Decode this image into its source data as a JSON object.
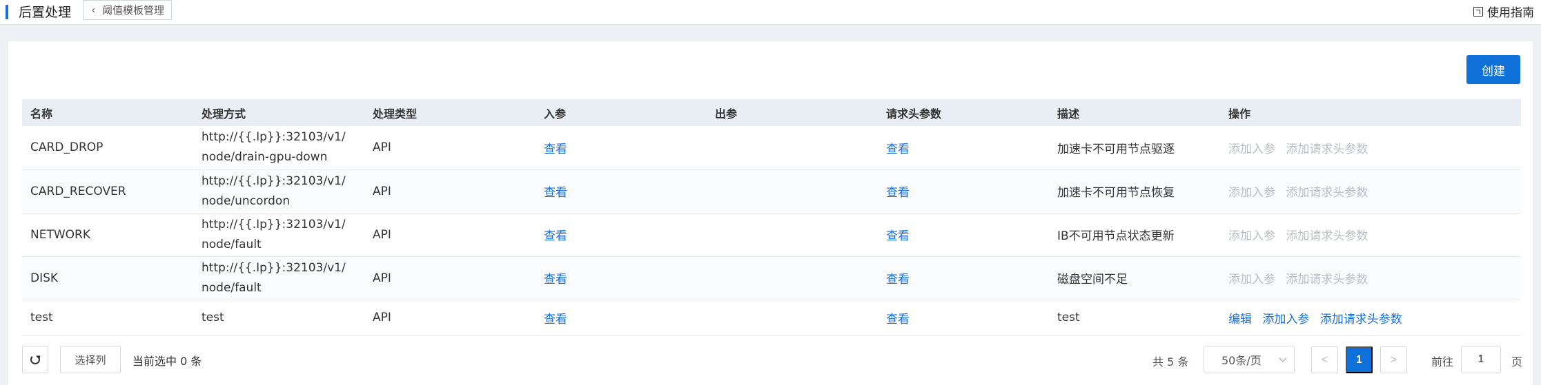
{
  "header": {
    "title": "后置处理",
    "back_label": "阈值模板管理",
    "guide_label": "使用指南"
  },
  "toolbar": {
    "create_label": "创建"
  },
  "table": {
    "columns": [
      "名称",
      "处理方式",
      "处理类型",
      "入参",
      "出参",
      "请求头参数",
      "描述",
      "操作"
    ],
    "rows": [
      {
        "name": "CARD_DROP",
        "method": "http://{{.Ip}}:32103/v1/node/drain-gpu-down",
        "type": "API",
        "input": "查看",
        "output": "",
        "headers": "查看",
        "desc": "加速卡不可用节点驱逐",
        "ops": [
          "添加入参",
          "添加请求头参数"
        ],
        "ops_enabled": false
      },
      {
        "name": "CARD_RECOVER",
        "method": "http://{{.Ip}}:32103/v1/node/uncordon",
        "type": "API",
        "input": "查看",
        "output": "",
        "headers": "查看",
        "desc": "加速卡不可用节点恢复",
        "ops": [
          "添加入参",
          "添加请求头参数"
        ],
        "ops_enabled": false
      },
      {
        "name": "NETWORK",
        "method": "http://{{.Ip}}:32103/v1/node/fault",
        "type": "API",
        "input": "查看",
        "output": "",
        "headers": "查看",
        "desc": "IB不可用节点状态更新",
        "ops": [
          "添加入参",
          "添加请求头参数"
        ],
        "ops_enabled": false
      },
      {
        "name": "DISK",
        "method": "http://{{.Ip}}:32103/v1/node/fault",
        "type": "API",
        "input": "查看",
        "output": "",
        "headers": "查看",
        "desc": "磁盘空间不足",
        "ops": [
          "添加入参",
          "添加请求头参数"
        ],
        "ops_enabled": false
      },
      {
        "name": "test",
        "method": "test",
        "type": "API",
        "input": "查看",
        "output": "",
        "headers": "查看",
        "desc": "test",
        "ops": [
          "编辑",
          "添加入参",
          "添加请求头参数"
        ],
        "ops_enabled": true
      }
    ]
  },
  "footer": {
    "select_columns_label": "选择列",
    "selected_info": "当前选中 0 条",
    "total": "共 5 条",
    "page_size": "50条/页",
    "prev": "<",
    "current_page": "1",
    "next": ">",
    "goto_label": "前往",
    "goto_value": "1",
    "goto_suffix": "页"
  },
  "colors": {
    "primary": "#1070d9",
    "header_bg": "#e9eef5",
    "disabled": "#b9bec5"
  }
}
